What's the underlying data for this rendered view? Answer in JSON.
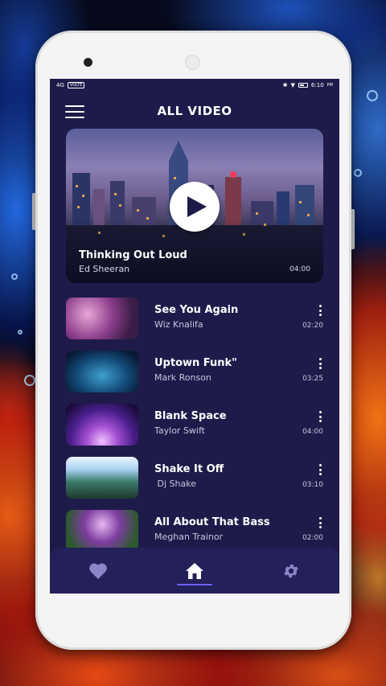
{
  "status_bar": {
    "left_network": "4G",
    "left_volte": "VOLTE",
    "time": "6:10",
    "ampm": "PM"
  },
  "header": {
    "title": "ALL VIDEO"
  },
  "featured": {
    "title": "Thinking Out Loud",
    "artist": "Ed Sheeran",
    "duration": "04:00"
  },
  "videos": [
    {
      "title": "See You Again",
      "artist": "Wiz Knalifa",
      "duration": "02:20"
    },
    {
      "title": "Uptown Funk\"",
      "artist": "Mark Ronson",
      "duration": "03:25"
    },
    {
      "title": "Blank Space",
      "artist": "Taylor Swift",
      "duration": "04:00"
    },
    {
      "title": "Shake It Off",
      "artist": " Dj Shake",
      "duration": "03:10"
    },
    {
      "title": "All About That Bass",
      "artist": "Meghan Trainor",
      "duration": "02:00"
    }
  ],
  "bottom_nav": {
    "items": [
      {
        "icon": "heart-icon"
      },
      {
        "icon": "home-icon",
        "active": true
      },
      {
        "icon": "gear-icon"
      }
    ]
  },
  "colors": {
    "screen_bg": "#1e1b4a",
    "nav_bg": "#23205a",
    "accent": "#6c63ff",
    "icon_inactive": "#8a85c4"
  }
}
